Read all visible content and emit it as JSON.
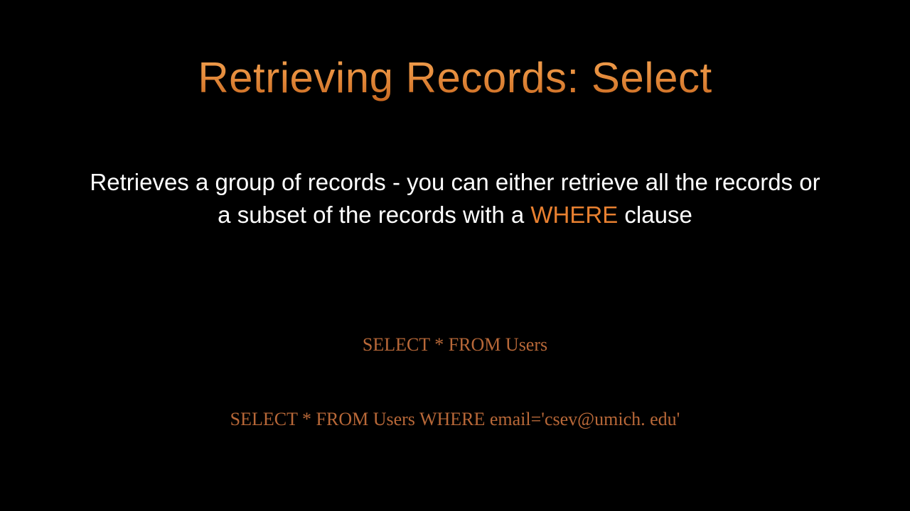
{
  "title": "Retrieving Records: Select",
  "description_part1": "Retrieves a group of records - you can either retrieve all the records or a subset of the records with a ",
  "description_keyword": "WHERE",
  "description_part2": " clause",
  "code1": "SELECT * FROM Users",
  "code2": "SELECT * FROM Users WHERE email='csev@umich. edu'"
}
